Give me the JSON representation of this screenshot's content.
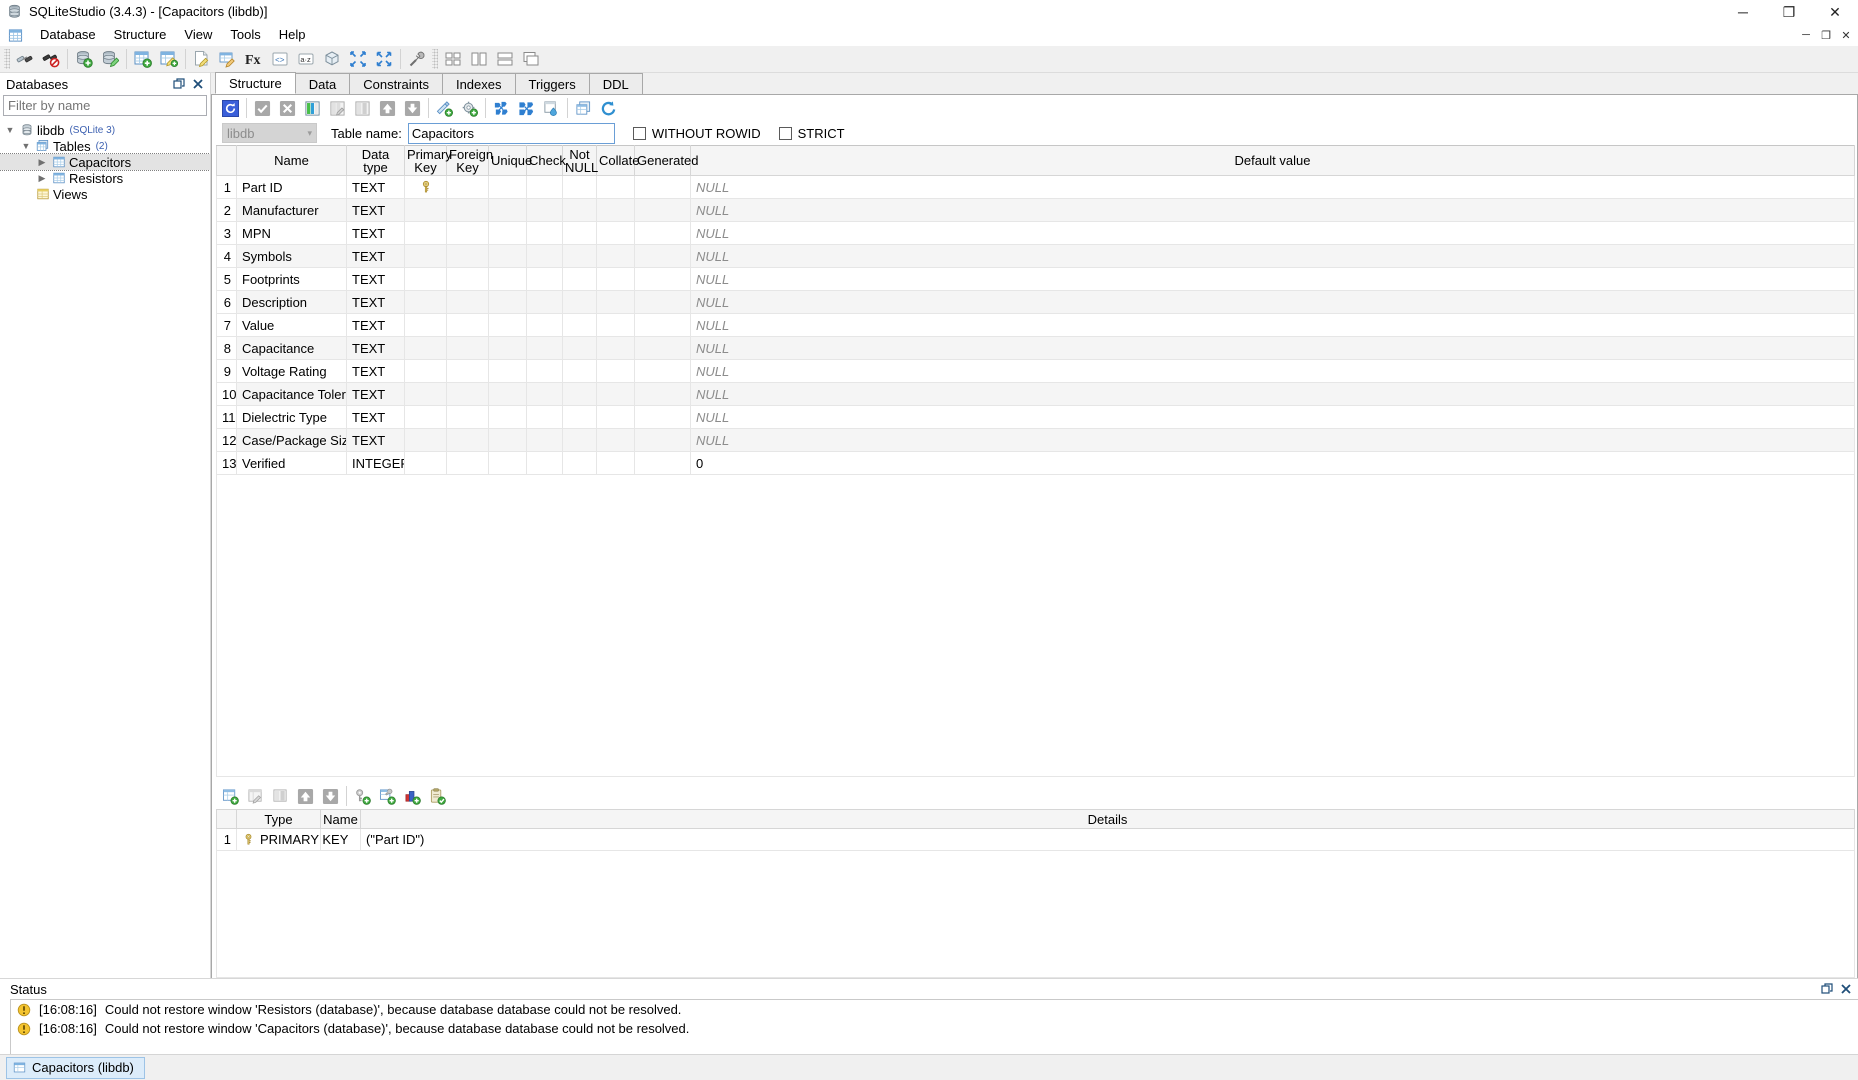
{
  "window": {
    "title": "SQLiteStudio (3.4.3) - [Capacitors (libdb)]",
    "app_icon": "database-icon",
    "minimize": "─",
    "maximize": "❐",
    "close": "✕"
  },
  "mdi_controls": {
    "restore": "❐",
    "minimize": "─",
    "close": "✕"
  },
  "menubar": {
    "doc_icon": "table-icon",
    "items": [
      {
        "label": "Database"
      },
      {
        "label": "Structure"
      },
      {
        "label": "View"
      },
      {
        "label": "Tools"
      },
      {
        "label": "Help"
      }
    ]
  },
  "main_toolbar": {
    "groups": [
      {
        "buttons": [
          {
            "name": "connect-to-database-icon",
            "title": "Connect to the database"
          },
          {
            "name": "disconnect-from-database-icon",
            "title": "Disconnect from the database"
          }
        ]
      },
      {
        "buttons": [
          {
            "name": "add-database-icon",
            "title": "Add a database"
          },
          {
            "name": "edit-database-icon",
            "title": "Edit the database"
          }
        ]
      },
      {
        "buttons": [
          {
            "name": "create-table-icon",
            "title": "Create a table"
          },
          {
            "name": "edit-table-icon",
            "title": "Edit the table"
          }
        ]
      },
      {
        "buttons": [
          {
            "name": "open-sql-editor-icon",
            "title": "Open SQL editor"
          },
          {
            "name": "open-ddl-history-icon",
            "title": "Open DDL history"
          },
          {
            "name": "function-editor-icon",
            "title": "Function editor",
            "glyph": "Fx"
          },
          {
            "name": "code-formatter-icon",
            "title": "Formatter"
          },
          {
            "name": "collation-editor-icon",
            "title": "Collation editor",
            "glyph": "a·z"
          },
          {
            "name": "extension-manager-icon",
            "title": "Extension manager"
          },
          {
            "name": "collapse-all-icon",
            "title": "Collapse all"
          },
          {
            "name": "expand-all-icon",
            "title": "Expand all"
          }
        ]
      },
      {
        "buttons": [
          {
            "name": "settings-icon",
            "title": "Open configuration dialog"
          }
        ]
      },
      {
        "buttons": [
          {
            "name": "tile-windows-icon",
            "title": "Tile windows"
          },
          {
            "name": "tile-horizontally-icon",
            "title": "Tile windows horizontally"
          },
          {
            "name": "tile-vertically-icon",
            "title": "Tile windows vertically"
          },
          {
            "name": "cascade-windows-icon",
            "title": "Cascade windows"
          }
        ]
      }
    ]
  },
  "databases_dock": {
    "title": "Databases",
    "undock_icon": "undock-icon",
    "close_icon": "close-icon",
    "filter": {
      "placeholder": "Filter by name",
      "value": ""
    },
    "tree": [
      {
        "label": "libdb",
        "sub": "(SQLite 3)",
        "icon": "database-icon",
        "level": 1,
        "expanded": true,
        "selected": false
      },
      {
        "label": "Tables",
        "sub": "(2)",
        "icon": "tables-icon",
        "level": 2,
        "expanded": true,
        "selected": false
      },
      {
        "label": "Capacitors",
        "sub": "",
        "icon": "table-icon",
        "level": 3,
        "expanded": false,
        "selected": true
      },
      {
        "label": "Resistors",
        "sub": "",
        "icon": "table-icon",
        "level": 3,
        "expanded": false,
        "selected": false
      },
      {
        "label": "Views",
        "sub": "",
        "icon": "views-icon",
        "level": 2,
        "expanded": false,
        "selected": false
      }
    ]
  },
  "tabs": [
    {
      "label": "Structure",
      "active": true
    },
    {
      "label": "Data",
      "active": false
    },
    {
      "label": "Constraints",
      "active": false
    },
    {
      "label": "Indexes",
      "active": false
    },
    {
      "label": "Triggers",
      "active": false
    },
    {
      "label": "DDL",
      "active": false
    }
  ],
  "structure_toolbar": {
    "buttons": [
      {
        "name": "refresh-structure-icon",
        "title": "Refresh structure",
        "active": true
      },
      {
        "name": "commit-structure-icon",
        "title": "Commit structure changes"
      },
      {
        "name": "rollback-structure-icon",
        "title": "Rollback structure changes"
      },
      {
        "name": "add-column-icon",
        "title": "Add column"
      },
      {
        "name": "edit-column-icon",
        "title": "Edit column"
      },
      {
        "name": "delete-column-icon",
        "title": "Delete column"
      },
      {
        "name": "move-column-up-icon",
        "title": "Move column up"
      },
      {
        "name": "move-column-down-icon",
        "title": "Move column down"
      },
      {
        "name": "create-index-icon",
        "title": "Create index"
      },
      {
        "name": "create-trigger-icon",
        "title": "Create trigger"
      },
      {
        "name": "export-table-icon",
        "title": "Export table"
      },
      {
        "name": "import-table-icon",
        "title": "Import data to table"
      },
      {
        "name": "populate-table-icon",
        "title": "Populate table"
      },
      {
        "name": "duplicate-table-icon",
        "title": "Duplicate table"
      },
      {
        "name": "reset-autoincrement-icon",
        "title": "Reset autoincrement value"
      }
    ]
  },
  "table_meta": {
    "database_selected": "libdb",
    "chevron": "▾",
    "table_name_label": "Table name:",
    "table_name_value": "Capacitors",
    "without_rowid": {
      "label": "WITHOUT ROWID",
      "checked": false
    },
    "strict": {
      "label": "STRICT",
      "checked": false
    }
  },
  "columns_grid": {
    "headers": [
      "",
      "Name",
      "Data type",
      "Primary\nKey",
      "Foreign\nKey",
      "Unique",
      "Check",
      "Not\nNULL",
      "Collate",
      "Generated",
      "Default value"
    ],
    "header_labels": {
      "rowno": "",
      "name": "Name",
      "datatype": "Data type",
      "primarykey_l1": "Primary",
      "primarykey_l2": "Key",
      "foreignkey_l1": "Foreign",
      "foreignkey_l2": "Key",
      "unique": "Unique",
      "check": "Check",
      "notnull_l1": "Not",
      "notnull_l2": "NULL",
      "collate": "Collate",
      "generated": "Generated",
      "defaultvalue": "Default value"
    },
    "rows": [
      {
        "no": "1",
        "name": "Part ID",
        "type": "TEXT",
        "pk": true,
        "fk": false,
        "unique": false,
        "check": false,
        "notnull": false,
        "collate": "",
        "generated": "",
        "default": "NULL",
        "default_is_null": true
      },
      {
        "no": "2",
        "name": "Manufacturer",
        "type": "TEXT",
        "pk": false,
        "fk": false,
        "unique": false,
        "check": false,
        "notnull": false,
        "collate": "",
        "generated": "",
        "default": "NULL",
        "default_is_null": true
      },
      {
        "no": "3",
        "name": "MPN",
        "type": "TEXT",
        "pk": false,
        "fk": false,
        "unique": false,
        "check": false,
        "notnull": false,
        "collate": "",
        "generated": "",
        "default": "NULL",
        "default_is_null": true
      },
      {
        "no": "4",
        "name": "Symbols",
        "type": "TEXT",
        "pk": false,
        "fk": false,
        "unique": false,
        "check": false,
        "notnull": false,
        "collate": "",
        "generated": "",
        "default": "NULL",
        "default_is_null": true
      },
      {
        "no": "5",
        "name": "Footprints",
        "type": "TEXT",
        "pk": false,
        "fk": false,
        "unique": false,
        "check": false,
        "notnull": false,
        "collate": "",
        "generated": "",
        "default": "NULL",
        "default_is_null": true
      },
      {
        "no": "6",
        "name": "Description",
        "type": "TEXT",
        "pk": false,
        "fk": false,
        "unique": false,
        "check": false,
        "notnull": false,
        "collate": "",
        "generated": "",
        "default": "NULL",
        "default_is_null": true
      },
      {
        "no": "7",
        "name": "Value",
        "type": "TEXT",
        "pk": false,
        "fk": false,
        "unique": false,
        "check": false,
        "notnull": false,
        "collate": "",
        "generated": "",
        "default": "NULL",
        "default_is_null": true
      },
      {
        "no": "8",
        "name": "Capacitance",
        "type": "TEXT",
        "pk": false,
        "fk": false,
        "unique": false,
        "check": false,
        "notnull": false,
        "collate": "",
        "generated": "",
        "default": "NULL",
        "default_is_null": true
      },
      {
        "no": "9",
        "name": "Voltage Rating",
        "type": "TEXT",
        "pk": false,
        "fk": false,
        "unique": false,
        "check": false,
        "notnull": false,
        "collate": "",
        "generated": "",
        "default": "NULL",
        "default_is_null": true
      },
      {
        "no": "10",
        "name": "Capacitance Tolerance",
        "type": "TEXT",
        "pk": false,
        "fk": false,
        "unique": false,
        "check": false,
        "notnull": false,
        "collate": "",
        "generated": "",
        "default": "NULL",
        "default_is_null": true
      },
      {
        "no": "11",
        "name": "Dielectric Type",
        "type": "TEXT",
        "pk": false,
        "fk": false,
        "unique": false,
        "check": false,
        "notnull": false,
        "collate": "",
        "generated": "",
        "default": "NULL",
        "default_is_null": true
      },
      {
        "no": "12",
        "name": "Case/Package Size",
        "type": "TEXT",
        "pk": false,
        "fk": false,
        "unique": false,
        "check": false,
        "notnull": false,
        "collate": "",
        "generated": "",
        "default": "NULL",
        "default_is_null": true
      },
      {
        "no": "13",
        "name": "Verified",
        "type": "INTEGER",
        "pk": false,
        "fk": false,
        "unique": false,
        "check": false,
        "notnull": false,
        "collate": "",
        "generated": "",
        "default": "0",
        "default_is_null": false
      }
    ]
  },
  "constraints_toolbar": {
    "buttons": [
      {
        "name": "add-table-constraint-icon",
        "title": "Add table constraint"
      },
      {
        "name": "edit-table-constraint-icon",
        "title": "Edit table constraint"
      },
      {
        "name": "delete-table-constraint-icon",
        "title": "Delete table constraint"
      },
      {
        "name": "move-constraint-up-icon",
        "title": "Move constraint up"
      },
      {
        "name": "move-constraint-down-icon",
        "title": "Move constraint down"
      },
      {
        "name": "add-primary-key-icon",
        "title": "Add table primary key"
      },
      {
        "name": "add-foreign-key-icon",
        "title": "Add table foreign key"
      },
      {
        "name": "add-unique-constraint-icon",
        "title": "Add table unique constraint"
      },
      {
        "name": "add-check-constraint-icon",
        "title": "Add table check constraint"
      }
    ]
  },
  "constraints_grid": {
    "headers": {
      "rowno": "",
      "type": "Type",
      "name": "Name",
      "details": "Details"
    },
    "rows": [
      {
        "no": "1",
        "icon": "primary-key-icon",
        "type": "PRIMARY KEY",
        "name": "",
        "details": "(\"Part ID\")"
      }
    ]
  },
  "status_dock": {
    "title": "Status",
    "undock_icon": "undock-icon",
    "close_icon": "close-icon",
    "messages": [
      {
        "icon": "warning-icon",
        "time": "[16:08:16]",
        "text": "Could not restore window 'Resistors (database)', because database database could not be resolved."
      },
      {
        "icon": "warning-icon",
        "time": "[16:08:16]",
        "text": "Could not restore window 'Capacitors (database)', because database database could not be resolved."
      }
    ]
  },
  "taskbar": {
    "items": [
      {
        "label": "Capacitors (libdb)",
        "icon": "table-window-icon",
        "active": true
      }
    ]
  },
  "colors": {
    "accent_blue": "#2a6fc9",
    "selection_grey": "#e3e3e3",
    "header_grey": "#f5f5f5",
    "null_text": "#8c8c8c",
    "tree_sub": "#3b5fb0",
    "key_gold": "#d8b44a",
    "warning_amber": "#f0a500",
    "task_active": "#dcecfa"
  }
}
